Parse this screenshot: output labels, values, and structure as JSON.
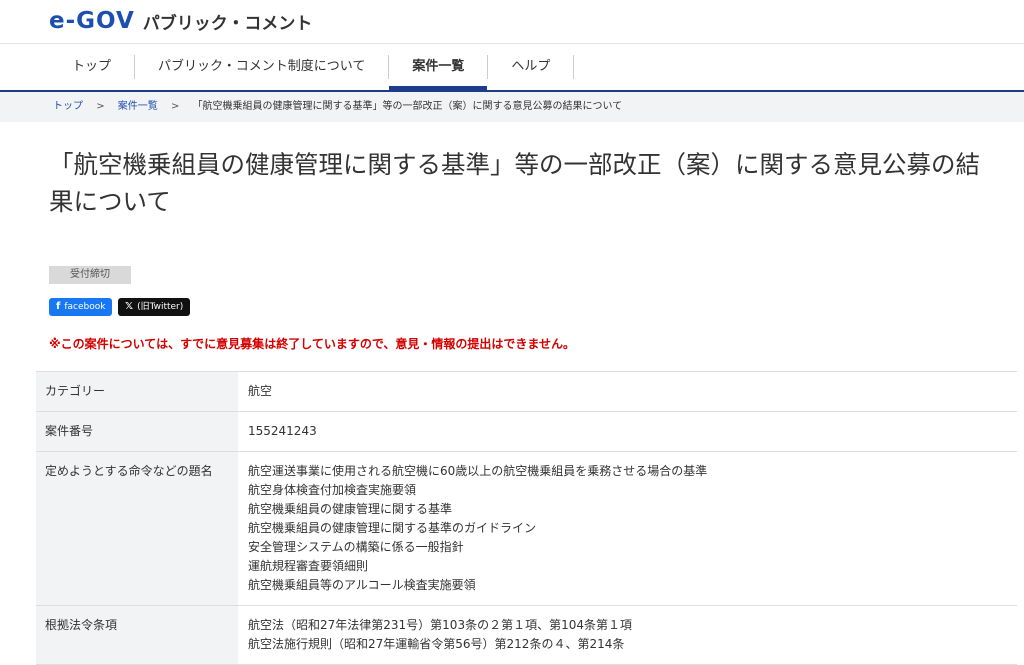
{
  "header": {
    "logo_mark": "e-GOV",
    "logo_text": "パブリック・コメント"
  },
  "nav": [
    "トップ",
    "パブリック・コメント制度について",
    "案件一覧",
    "ヘルプ"
  ],
  "breadcrumb": {
    "items": [
      "トップ",
      "案件一覧",
      "「航空機乗組員の健康管理に関する基準」等の一部改正（案）に関する意見公募の結果について"
    ],
    "separator": ">"
  },
  "title": "「航空機乗組員の健康管理に関する基準」等の一部改正（案）に関する意見公募の結果について",
  "status": "受付締切",
  "share": {
    "facebook": "facebook",
    "twitter": "(旧Twitter)"
  },
  "notice": "※この案件については、すでに意見募集は終了していますので、意見・情報の提出はできません。",
  "table": {
    "rows": [
      {
        "label": "カテゴリー",
        "lines": [
          "航空"
        ]
      },
      {
        "label": "案件番号",
        "lines": [
          "155241243"
        ]
      },
      {
        "label": "定めようとする命令などの題名",
        "lines": [
          "航空運送事業に使用される航空機に60歳以上の航空機乗組員を乗務させる場合の基準",
          "航空身体検査付加検査実施要領",
          "航空機乗組員の健康管理に関する基準",
          "航空機乗組員の健康管理に関する基準のガイドライン",
          "安全管理システムの構築に係る一般指針",
          "運航規程審査要領細則",
          "航空機乗組員等のアルコール検査実施要領"
        ]
      },
      {
        "label": "根拠法令条項",
        "lines": [
          "航空法（昭和27年法律第231号）第103条の２第１項、第104条第１項",
          "航空法施行規則（昭和27年運輸省令第56号）第212条の４、第214条"
        ]
      }
    ]
  }
}
